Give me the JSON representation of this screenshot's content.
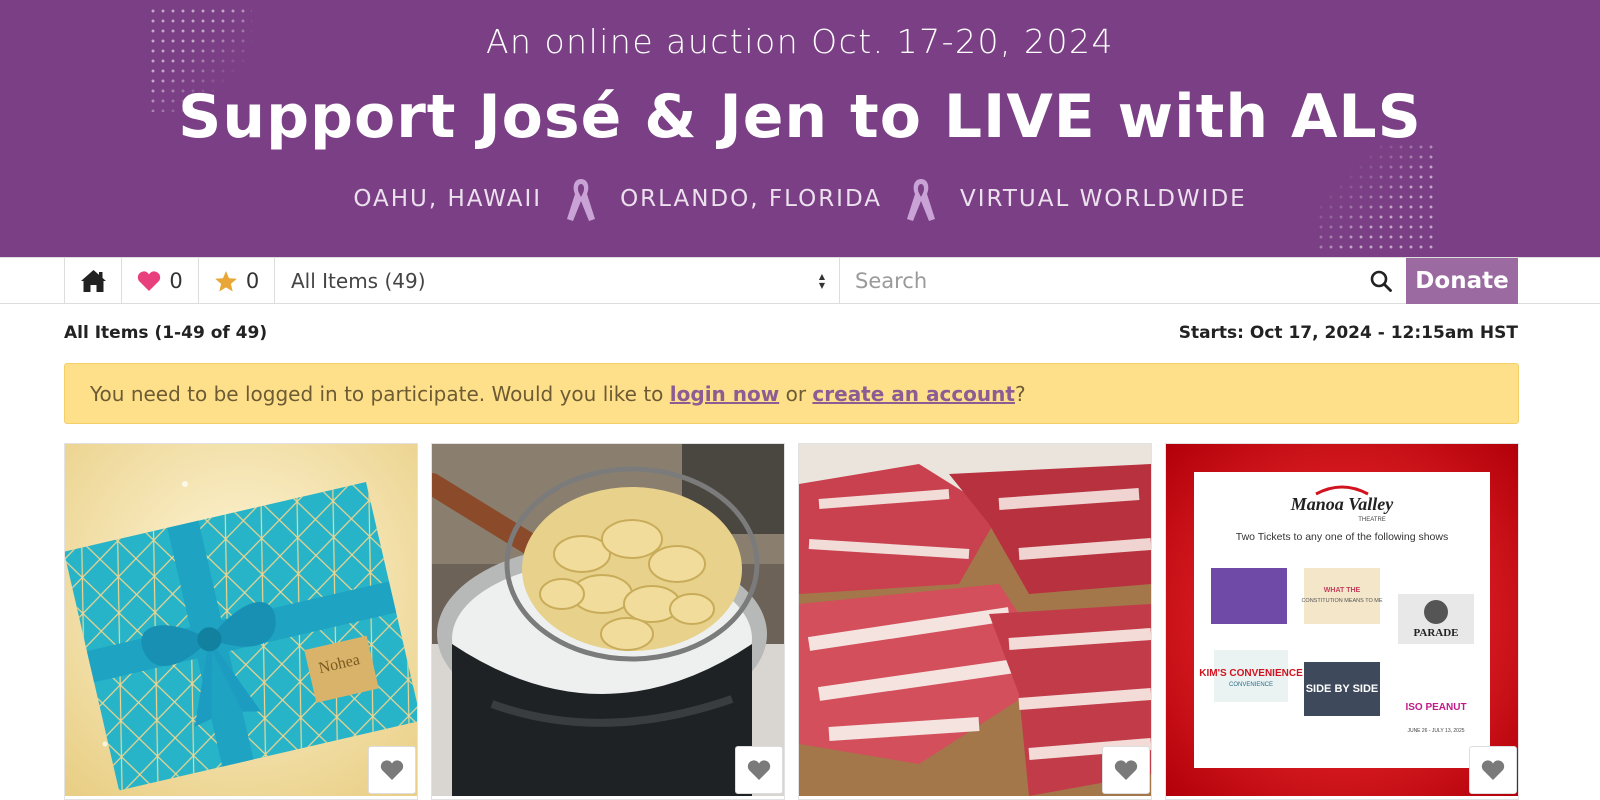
{
  "hero": {
    "subtitle": "An online auction Oct. 17-20, 2024",
    "title": "Support José & Jen to LIVE with ALS",
    "locations": [
      "OAHU, HAWAII",
      "ORLANDO, FLORIDA",
      "VIRTUAL WORLDWIDE"
    ],
    "background_color": "#7a3f84"
  },
  "nav": {
    "home_icon": "home-icon",
    "watch_count": "0",
    "favorite_count": "0",
    "category_select": "All Items (49)",
    "search_placeholder": "Search",
    "donate_label": "Donate",
    "donate_color": "#9b6aa1"
  },
  "listing": {
    "count_label": "All Items (1-49 of 49)",
    "starts_label": "Starts: Oct 17, 2024 - 12:15am HST"
  },
  "alert": {
    "text_before": "You need to be logged in to participate. Would you like to ",
    "login_link": "login now",
    "text_middle": " or ",
    "create_link": "create an account",
    "text_after": "?"
  },
  "items": [
    {
      "image": "teal-gift-box-photo"
    },
    {
      "image": "wontons-in-strainer-photo"
    },
    {
      "image": "sliced-raw-pork-belly-photo"
    },
    {
      "image": "theatre-tickets-flyer",
      "flyer_logo": "Manoa Valley",
      "flyer_logo_sub": "THEATRE",
      "flyer_heading": "Two Tickets to any one of the following shows",
      "flyer_shows": [
        "WHAT THE CONSTITUTION MEANS TO ME",
        "PARADE",
        "KIM'S CONVENIENCE",
        "SIDE BY SIDE",
        "ISO PEANUT"
      ]
    }
  ]
}
